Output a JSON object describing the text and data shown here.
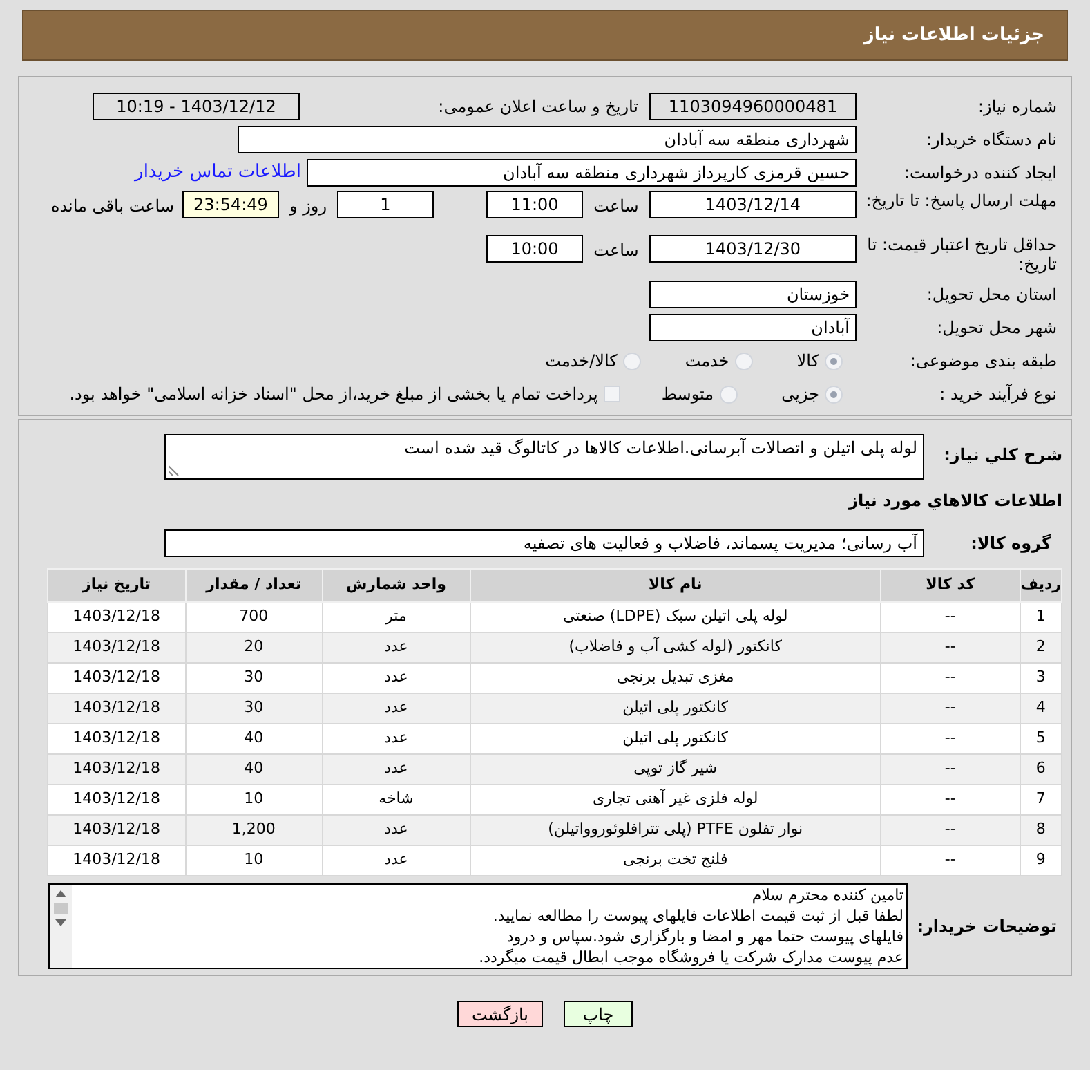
{
  "header": {
    "title": "جزئیات اطلاعات نیاز"
  },
  "details": {
    "need_number": {
      "label": "شماره نیاز:",
      "value": "1103094960000481"
    },
    "announce": {
      "label": "تاریخ و ساعت اعلان عمومی:",
      "value": "1403/12/12 - 10:19"
    },
    "buyer_org": {
      "label": "نام دستگاه خریدار:",
      "value": "شهرداری منطقه سه آبادان"
    },
    "requester": {
      "label": "ایجاد کننده درخواست:",
      "value": "حسین قرمزی کارپرداز شهرداری منطقه سه آبادان",
      "link": "اطلاعات تماس خریدار"
    },
    "response_deadline": {
      "label": "مهلت ارسال پاسخ: تا تاریخ:",
      "date": "1403/12/14",
      "time_label": "ساعت",
      "time": "11:00",
      "days": "1",
      "days_label": "روز و",
      "remaining": "23:54:49",
      "remaining_label": "ساعت باقی مانده"
    },
    "price_validity": {
      "label": "حداقل تاریخ اعتبار قیمت: تا تاریخ:",
      "date": "1403/12/30",
      "time_label": "ساعت",
      "time": "10:00"
    },
    "province": {
      "label": "استان محل تحویل:",
      "value": "خوزستان"
    },
    "city": {
      "label": "شهر محل تحویل:",
      "value": "آبادان"
    },
    "category": {
      "label": "طبقه بندی موضوعی:",
      "options": [
        {
          "label": "کالا",
          "selected": true
        },
        {
          "label": "خدمت",
          "selected": false
        },
        {
          "label": "کالا/خدمت",
          "selected": false
        }
      ]
    },
    "process": {
      "label": "نوع فرآیند خرید :",
      "options": [
        {
          "label": "جزیی",
          "selected": true
        },
        {
          "label": "متوسط",
          "selected": false
        }
      ],
      "payment": {
        "label": "پرداخت تمام یا بخشی از مبلغ خرید،از محل \"اسناد خزانه اسلامی\" خواهد بود.",
        "checked": false
      }
    }
  },
  "description": {
    "label": "شرح کلي نياز:",
    "value": "لوله پلی اتیلن و اتصالات آبرسانی.اطلاعات کالاها در کاتالوگ قید شده است"
  },
  "goods_title": "اطلاعات کالاهاي مورد نياز",
  "goods_group": {
    "label": "گروه کالا:",
    "value": "آب رسانی؛ مدیریت پسماند، فاضلاب و فعالیت های تصفیه"
  },
  "table": {
    "columns": [
      "ردیف",
      "کد کالا",
      "نام کالا",
      "واحد شمارش",
      "تعداد / مقدار",
      "تاریخ نیاز"
    ],
    "rows": [
      [
        "1",
        "--",
        "لوله پلی اتیلن سبک (LDPE) صنعتی",
        "متر",
        "700",
        "1403/12/18"
      ],
      [
        "2",
        "--",
        "کانکتور (لوله کشی آب و فاضلاب)",
        "عدد",
        "20",
        "1403/12/18"
      ],
      [
        "3",
        "--",
        "مغزی تبدیل برنجی",
        "عدد",
        "30",
        "1403/12/18"
      ],
      [
        "4",
        "--",
        "کانکتور پلی اتیلن",
        "عدد",
        "30",
        "1403/12/18"
      ],
      [
        "5",
        "--",
        "کانکتور پلی اتیلن",
        "عدد",
        "40",
        "1403/12/18"
      ],
      [
        "6",
        "--",
        "شیر گاز توپی",
        "عدد",
        "40",
        "1403/12/18"
      ],
      [
        "7",
        "--",
        "لوله فلزی غیر آهنی تجاری",
        "شاخه",
        "10",
        "1403/12/18"
      ],
      [
        "8",
        "--",
        "نوار تفلون PTFE (پلی تترافلوئوروواتیلن)",
        "عدد",
        "1,200",
        "1403/12/18"
      ],
      [
        "9",
        "--",
        "فلنج تخت برنجی",
        "عدد",
        "10",
        "1403/12/18"
      ]
    ]
  },
  "buyer_notes": {
    "label": "توضیحات خریدار:",
    "lines": [
      "تامین کننده محترم سلام",
      "لطفا قبل از ثبت قیمت اطلاعات فایلهای پیوست را مطالعه نمایید.",
      "فایلهای پیوست حتما مهر و امضا و بارگزاری شود.سپاس و درود",
      "عدم پیوست مدارک شرکت یا فروشگاه موجب ابطال قیمت میگردد."
    ]
  },
  "buttons": [
    {
      "kind": "print",
      "label": "چاپ"
    },
    {
      "kind": "back",
      "label": "بازگشت"
    }
  ]
}
